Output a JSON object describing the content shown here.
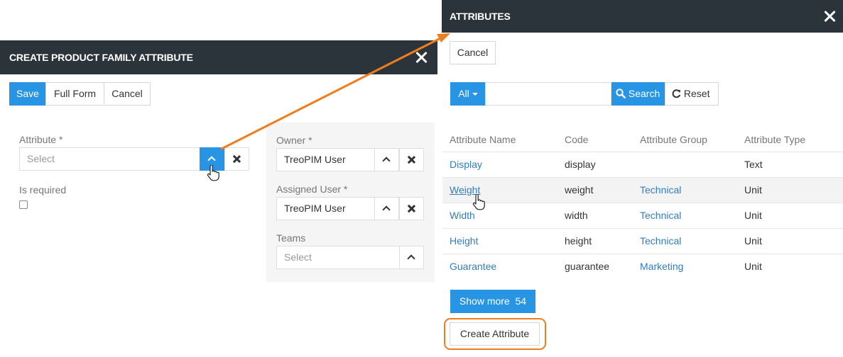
{
  "left_dialog": {
    "title": "CREATE PRODUCT FAMILY ATTRIBUTE",
    "buttons": {
      "save": "Save",
      "full_form": "Full Form",
      "cancel": "Cancel"
    },
    "attribute": {
      "label": "Attribute *",
      "placeholder": "Select"
    },
    "is_required": {
      "label": "Is required",
      "checked": false
    },
    "owner": {
      "label": "Owner *",
      "value": "TreoPIM User"
    },
    "assigned_user": {
      "label": "Assigned User *",
      "value": "TreoPIM User"
    },
    "teams": {
      "label": "Teams",
      "placeholder": "Select"
    }
  },
  "right_dialog": {
    "title": "ATTRIBUTES",
    "cancel_label": "Cancel",
    "filter": {
      "scope": "All",
      "search_value": "",
      "search_label": "Search",
      "reset_label": "Reset"
    },
    "table": {
      "columns": [
        "Attribute Name",
        "Code",
        "Attribute Group",
        "Attribute Type"
      ],
      "rows": [
        {
          "name": "Display",
          "code": "display",
          "group": "",
          "type": "Text"
        },
        {
          "name": "Weight",
          "code": "weight",
          "group": "Technical",
          "type": "Unit"
        },
        {
          "name": "Width",
          "code": "width",
          "group": "Technical",
          "type": "Unit"
        },
        {
          "name": "Height",
          "code": "height",
          "group": "Technical",
          "type": "Unit"
        },
        {
          "name": "Guarantee",
          "code": "guarantee",
          "group": "Marketing",
          "type": "Unit"
        }
      ]
    },
    "show_more": {
      "label": "Show more",
      "count": "54"
    },
    "create_label": "Create Attribute"
  },
  "colors": {
    "header": "#2c343b",
    "primary": "#2895e4",
    "link": "#2f7ec0",
    "highlight": "#f07d1c"
  },
  "icons": [
    "close-icon",
    "chevron-up-icon",
    "clear-icon",
    "search-icon",
    "reset-icon",
    "caret-down-icon",
    "hand-cursor-icon",
    "arrow-annotation"
  ]
}
